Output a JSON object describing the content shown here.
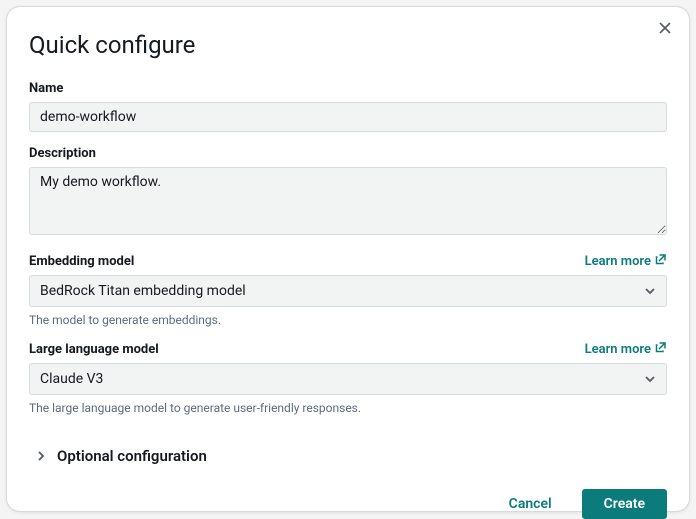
{
  "title": "Quick configure",
  "fields": {
    "name": {
      "label": "Name",
      "value": "demo-workflow"
    },
    "description": {
      "label": "Description",
      "value": "My demo workflow."
    },
    "embedding": {
      "label": "Embedding model",
      "learn_more": "Learn more",
      "value": "BedRock Titan embedding model",
      "help": "The model to generate embeddings."
    },
    "llm": {
      "label": "Large language model",
      "learn_more": "Learn more",
      "value": "Claude V3",
      "help": "The large language model to generate user-friendly responses."
    }
  },
  "optional_label": "Optional configuration",
  "buttons": {
    "cancel": "Cancel",
    "create": "Create"
  }
}
